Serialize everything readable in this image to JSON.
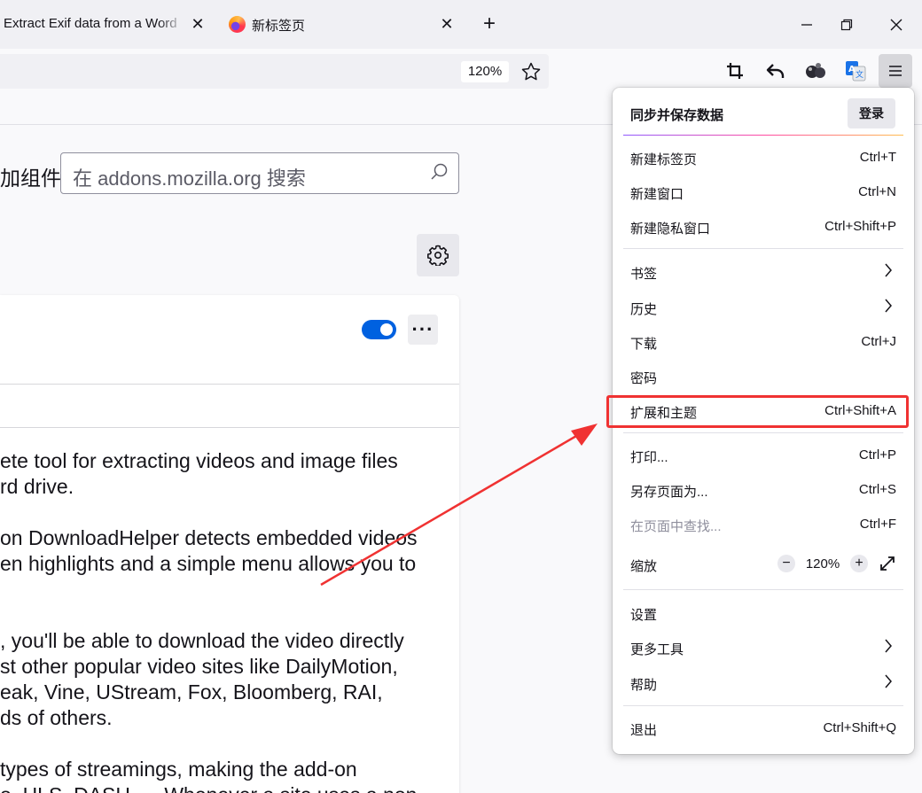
{
  "tabs": [
    {
      "title": "Extract Exif data from a Word",
      "close": "✕"
    },
    {
      "title": "新标签页",
      "close": "✕"
    }
  ],
  "new_tab": "+",
  "url_bar": {
    "zoom": "120%"
  },
  "content": {
    "heading": "加组件",
    "search_placeholder": "在 addons.mozilla.org 搜索",
    "more": "···",
    "description": [
      "ete tool for extracting videos and image files",
      "rd drive.",
      "",
      "on DownloadHelper detects embedded videos",
      "en highlights and a simple menu allows you to",
      "",
      ", you'll be able to download the video directly",
      "st other popular video sites like DailyMotion,",
      "eak, Vine, UStream, Fox, Bloomberg, RAI,",
      "ds of others.",
      "",
      "types of streamings, making the add-on",
      "o, HLS, DASH, ... Whenever a site uses a non-"
    ]
  },
  "app_menu": {
    "sync_title": "同步并保存数据",
    "login": "登录",
    "items": [
      {
        "label": "新建标签页",
        "shortcut": "Ctrl+T"
      },
      {
        "label": "新建窗口",
        "shortcut": "Ctrl+N"
      },
      {
        "label": "新建隐私窗口",
        "shortcut": "Ctrl+Shift+P"
      },
      {
        "label": "书签",
        "shortcut": ""
      },
      {
        "label": "历史",
        "shortcut": ""
      },
      {
        "label": "下载",
        "shortcut": "Ctrl+J"
      },
      {
        "label": "密码",
        "shortcut": ""
      },
      {
        "label": "扩展和主题",
        "shortcut": "Ctrl+Shift+A"
      },
      {
        "label": "打印...",
        "shortcut": "Ctrl+P"
      },
      {
        "label": "另存页面为...",
        "shortcut": "Ctrl+S"
      },
      {
        "label": "在页面中查找...",
        "shortcut": "Ctrl+F"
      },
      {
        "label": "缩放",
        "shortcut": ""
      },
      {
        "label": "设置",
        "shortcut": ""
      },
      {
        "label": "更多工具",
        "shortcut": ""
      },
      {
        "label": "帮助",
        "shortcut": ""
      },
      {
        "label": "退出",
        "shortcut": "Ctrl+Shift+Q"
      }
    ],
    "zoom": {
      "minus": "−",
      "value": "120%",
      "plus": "+"
    }
  },
  "colors": {
    "accent": "#0061e0",
    "annotation": "#f03232",
    "menu_highlight_border": "#f03232"
  }
}
